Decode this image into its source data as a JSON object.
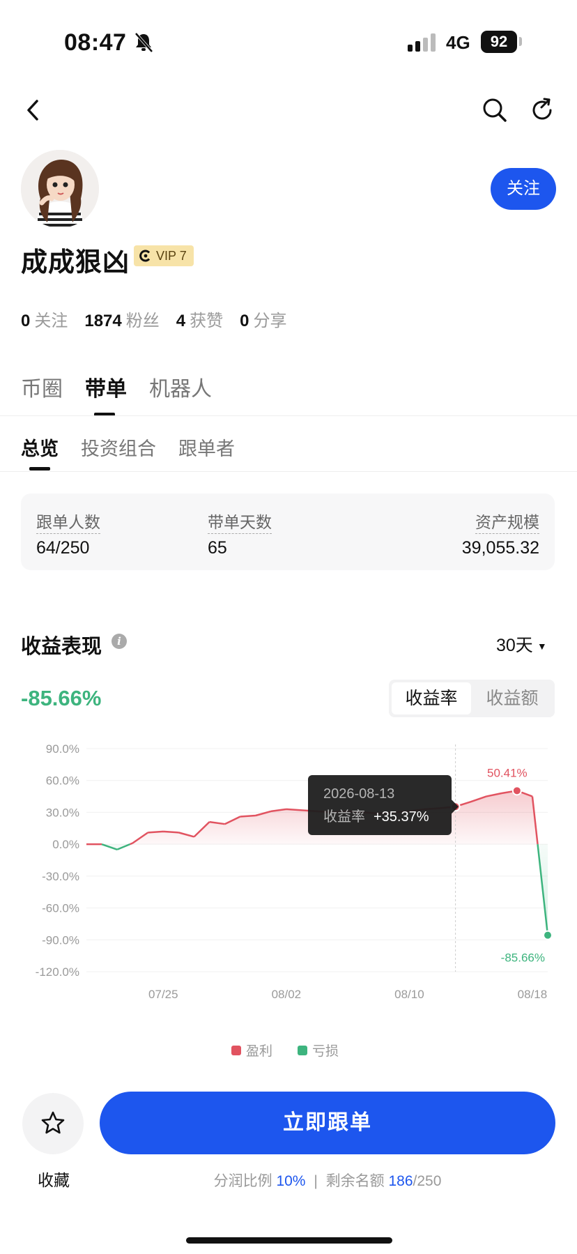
{
  "status_bar": {
    "time": "08:47",
    "network": "4G",
    "battery": "92"
  },
  "profile": {
    "follow_label": "关注",
    "name": "成成狠凶",
    "vip_label": "VIP 7",
    "stats": [
      {
        "value": "0",
        "label": "关注"
      },
      {
        "value": "1874",
        "label": "粉丝"
      },
      {
        "value": "4",
        "label": "获赞"
      },
      {
        "value": "0",
        "label": "分享"
      }
    ]
  },
  "main_tabs": [
    "币圈",
    "带单",
    "机器人"
  ],
  "main_tab_active": "带单",
  "sub_tabs": [
    "总览",
    "投资组合",
    "跟单者"
  ],
  "sub_tab_active": "总览",
  "overview": {
    "followers_label": "跟单人数",
    "followers_value": "64/250",
    "days_label": "带单天数",
    "days_value": "65",
    "aum_label": "资产规模",
    "aum_value": "39,055.32"
  },
  "performance": {
    "title": "收益表现",
    "range": "30天",
    "value": "-85.66%",
    "toggle": [
      "收益率",
      "收益额"
    ],
    "toggle_active": "收益率"
  },
  "chart_data": {
    "type": "line",
    "yticks": [
      "90.0%",
      "60.0%",
      "30.0%",
      "0.0%",
      "-30.0%",
      "-60.0%",
      "-90.0%",
      "-120.0%"
    ],
    "ylim": [
      -120,
      90
    ],
    "xticks": [
      "07/25",
      "08/02",
      "08/10",
      "08/18"
    ],
    "x": [
      "07/20",
      "07/21",
      "07/22",
      "07/23",
      "07/24",
      "07/25",
      "07/26",
      "07/27",
      "07/28",
      "07/29",
      "07/30",
      "07/31",
      "08/01",
      "08/02",
      "08/03",
      "08/04",
      "08/05",
      "08/06",
      "08/07",
      "08/08",
      "08/09",
      "08/10",
      "08/11",
      "08/12",
      "08/13",
      "08/14",
      "08/15",
      "08/16",
      "08/17",
      "08/18",
      "08/19"
    ],
    "values": [
      0,
      0,
      -5,
      1,
      11,
      12,
      11,
      7,
      21,
      19,
      26,
      27,
      31,
      33,
      32,
      31,
      30,
      31,
      30,
      29,
      30,
      31,
      33,
      34,
      35.37,
      40,
      45,
      48,
      50.41,
      45,
      -85.66
    ],
    "tooltip": {
      "date": "2026-08-13",
      "label": "收益率",
      "value": "+35.37%"
    },
    "max_label": "50.41%",
    "last_label": "-85.66%",
    "legend": [
      {
        "name": "盈利",
        "color": "#e15360"
      },
      {
        "name": "亏损",
        "color": "#3db47e"
      }
    ]
  },
  "bottom": {
    "fav_label": "收藏",
    "cta_label": "立即跟单",
    "share_label": "分润比例",
    "share_value": "10%",
    "remaining_label": "剩余名额",
    "remaining_value": "186",
    "remaining_total": "/250",
    "separator": "|"
  }
}
